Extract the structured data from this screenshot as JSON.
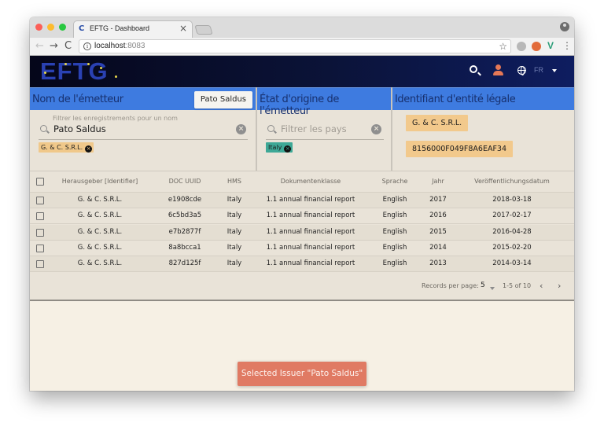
{
  "browser": {
    "tab_title": "EFTG - Dashboard",
    "tab_favicon": "C",
    "tab_close": "×",
    "url_host": "localhost",
    "url_port": ":8083",
    "nav": {
      "back": "←",
      "forward": "→",
      "reload": "C"
    },
    "bookmark_star": "☆",
    "extensions": [
      "adblock-icon",
      "duckduckgo-icon",
      "vue-devtools-icon"
    ],
    "vue_glyph": "V",
    "menu": "⋮"
  },
  "header": {
    "logo_text": "EFTG",
    "language": "FR",
    "icons": [
      "search-icon",
      "user-icon",
      "globe-icon",
      "caret-down-icon"
    ]
  },
  "filters": {
    "issuer_name": {
      "title": "Nom de l'émetteur",
      "selected_button": "Pato Saldus",
      "hint": "Filtrer les enregistrements pour un nom",
      "value": "Pato Saldus",
      "chips": [
        {
          "label": "G. & C. S.R.L."
        }
      ]
    },
    "home_state": {
      "title": "État d'origine de l'émetteur",
      "placeholder": "Filtrer les pays",
      "chips": [
        {
          "label": "Italy"
        }
      ]
    },
    "lei": {
      "title": "Identifiant d'entité légale",
      "items": [
        "G. & C. S.R.L.",
        "8156000F049F8A6EAF34"
      ]
    },
    "clear_glyph": "×",
    "chip_close_glyph": "×"
  },
  "table": {
    "columns": [
      "Herausgeber [Identifier]",
      "DOC UUID",
      "HMS",
      "Dokumentenklasse",
      "Sprache",
      "Jahr",
      "Veröffentlichungsdatum"
    ],
    "rows": [
      [
        "G. & C. S.R.L.",
        "e1908cde",
        "Italy",
        "1.1 annual financial report",
        "English",
        "2017",
        "2018-03-18"
      ],
      [
        "G. & C. S.R.L.",
        "6c5bd3a5",
        "Italy",
        "1.1 annual financial report",
        "English",
        "2016",
        "2017-02-17"
      ],
      [
        "G. & C. S.R.L.",
        "e7b2877f",
        "Italy",
        "1.1 annual financial report",
        "English",
        "2015",
        "2016-04-28"
      ],
      [
        "G. & C. S.R.L.",
        "8a8bcca1",
        "Italy",
        "1.1 annual financial report",
        "English",
        "2014",
        "2015-02-20"
      ],
      [
        "G. & C. S.R.L.",
        "827d125f",
        "Italy",
        "1.1 annual financial report",
        "English",
        "2013",
        "2014-03-14"
      ]
    ],
    "pagination": {
      "label": "Records per page:",
      "per_page": "5",
      "range": "1-5 of 10",
      "prev": "‹",
      "next": "›"
    }
  },
  "toast": {
    "message": "Selected Issuer \"Pato Saldus\""
  },
  "colors": {
    "panel_header": "#3e7be0",
    "header_bg": "#0b1338",
    "chip_orange": "#f0c88a",
    "chip_teal": "#3ea896",
    "toast": "#e07a63",
    "user_icon": "#e57856"
  }
}
